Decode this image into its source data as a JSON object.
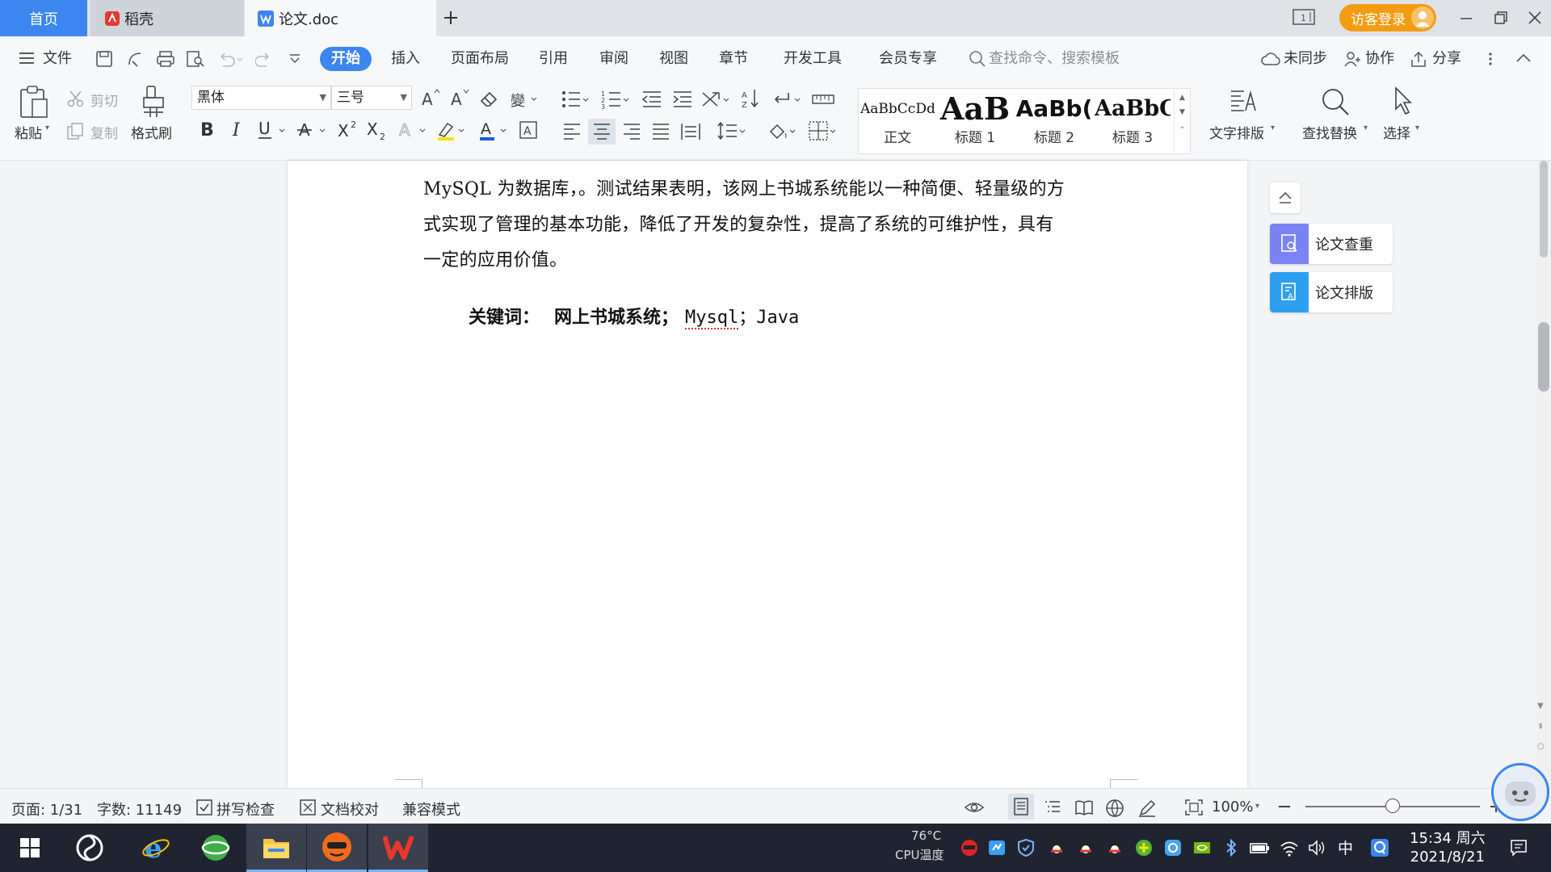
{
  "tabs": {
    "home": "首页",
    "daoke": "稻壳",
    "doc": "论文.doc"
  },
  "login": "访客登录",
  "menu": {
    "file": "文件",
    "items": [
      "开始",
      "插入",
      "页面布局",
      "引用",
      "审阅",
      "视图",
      "章节",
      "开发工具",
      "会员专享"
    ],
    "search_placeholder": "查找命令、搜索模板",
    "unsync": "未同步",
    "collab": "协作",
    "share": "分享"
  },
  "ribbon": {
    "paste": "粘贴",
    "cut": "剪切",
    "copy": "复制",
    "format_painter": "格式刷",
    "font_name": "黑体",
    "font_size": "三号",
    "styles": [
      {
        "preview": "AaBbCcDd",
        "label": "正文"
      },
      {
        "preview": "AaB",
        "label": "标题 1"
      },
      {
        "preview": "AaBb(",
        "label": "标题 2"
      },
      {
        "preview": "AaBbC",
        "label": "标题 3"
      }
    ],
    "text_layout": "文字排版",
    "find_replace": "查找替换",
    "select": "选择"
  },
  "document": {
    "paragraph_lines": [
      "MySQL 为数据库，。测试结果表明，该网上书城系统能以一种简便、轻量级的方",
      "式实现了管理的基本功能，降低了开发的复杂性，提高了系统的可维护性，具有",
      "一定的应用价值。"
    ],
    "keywords_label": "关键词：",
    "keyword_1": "网上书城系统；",
    "keyword_2": "Mysql",
    "keyword_sep": "；",
    "keyword_3": "Java"
  },
  "side_panel": {
    "check": "论文查重",
    "layout": "论文排版"
  },
  "status": {
    "page": "页面: 1/31",
    "words": "字数: 11149",
    "spell": "拼写检查",
    "proof": "文档校对",
    "compat": "兼容模式",
    "zoom": "100%",
    "zoom_level": 0.5
  },
  "taskbar": {
    "temp": "76°C",
    "temp_label": "CPU温度",
    "ime": "中",
    "time": "15:34 周六",
    "date": "2021/8/21"
  },
  "colors": {
    "accent": "#3d86f0",
    "login": "#f39c12",
    "wps_red": "#e8372c"
  }
}
